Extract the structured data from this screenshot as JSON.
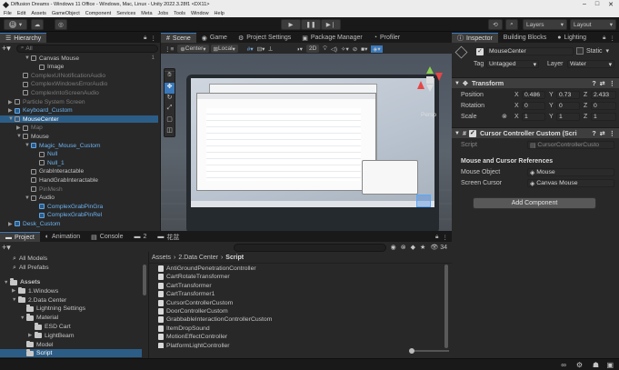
{
  "window": {
    "title": "Diffusion Dreams - Windows 11 Office - Windows, Mac, Linux - Unity 2022.3.28f1 <DX11>",
    "controls": [
      "–",
      "□",
      "✕"
    ]
  },
  "menu": [
    "File",
    "Edit",
    "Assets",
    "GameObject",
    "Component",
    "Services",
    "Meta",
    "Jobs",
    "Tools",
    "Window",
    "Help"
  ],
  "toolbar": {
    "account_initial": "R",
    "layers_label": "Layers",
    "layout_label": "Layout",
    "play_icon": "play-icon",
    "pause_icon": "pause-icon",
    "step_icon": "step-icon"
  },
  "hierarchy": {
    "tab": "Hierarchy",
    "search_placeholder": "All",
    "items": [
      {
        "label": "Canvas Mouse",
        "indent": 5,
        "icon": "cube",
        "arrow": "▼",
        "style": "normal",
        "right": "1"
      },
      {
        "label": "Image",
        "indent": 6,
        "icon": "cube",
        "arrow": "",
        "style": "normal"
      },
      {
        "label": "ComplexUINotificationAudio",
        "indent": 4,
        "icon": "cube",
        "arrow": "",
        "style": "dim"
      },
      {
        "label": "ComplexWindowsErrorAudio",
        "indent": 4,
        "icon": "cube",
        "arrow": "",
        "style": "dim"
      },
      {
        "label": "ComplexIntoScreenAudio",
        "indent": 4,
        "icon": "cube",
        "arrow": "",
        "style": "dim"
      },
      {
        "label": "Particle System Screen",
        "indent": 3,
        "icon": "cube",
        "arrow": "▶",
        "style": "dim"
      },
      {
        "label": "Keyboard_Custom",
        "indent": 3,
        "icon": "prefab",
        "arrow": "▶",
        "style": "blue"
      },
      {
        "label": "MouseCenter",
        "indent": 3,
        "icon": "cube",
        "arrow": "▼",
        "style": "selected"
      },
      {
        "label": "Map",
        "indent": 4,
        "icon": "cube",
        "arrow": "▶",
        "style": "dim"
      },
      {
        "label": "Mouse",
        "indent": 4,
        "icon": "cube",
        "arrow": "▼",
        "style": "normal"
      },
      {
        "label": "Magic_Mouse_Custom",
        "indent": 5,
        "icon": "prefab",
        "arrow": "▼",
        "style": "blue"
      },
      {
        "label": "Null",
        "indent": 6,
        "icon": "cube",
        "arrow": "",
        "style": "blue"
      },
      {
        "label": "Null_1",
        "indent": 6,
        "icon": "cube",
        "arrow": "",
        "style": "blue"
      },
      {
        "label": "GrabInteractable",
        "indent": 5,
        "icon": "cube",
        "arrow": "",
        "style": "normal"
      },
      {
        "label": "HandGrabInteractable",
        "indent": 5,
        "icon": "cube",
        "arrow": "",
        "style": "normal"
      },
      {
        "label": "PinMesh",
        "indent": 5,
        "icon": "cube",
        "arrow": "",
        "style": "dim"
      },
      {
        "label": "Audio",
        "indent": 5,
        "icon": "cube",
        "arrow": "▼",
        "style": "normal"
      },
      {
        "label": "ComplexGrabPinGra",
        "indent": 6,
        "icon": "prefab",
        "arrow": "",
        "style": "blue"
      },
      {
        "label": "ComplexGrabPinRel",
        "indent": 6,
        "icon": "prefab",
        "arrow": "",
        "style": "blue"
      },
      {
        "label": "Desk_Custom",
        "indent": 3,
        "icon": "prefab",
        "arrow": "▶",
        "style": "blue"
      }
    ]
  },
  "scene": {
    "tabs": [
      "Scene",
      "Game",
      "Project Settings",
      "Package Manager",
      "Profiler"
    ],
    "pivot_label": "Center",
    "space_label": "Local",
    "mode_2d": "2D",
    "persp_label": "Persp",
    "tools": [
      "hand-tool-icon",
      "move-tool-icon",
      "rotate-tool-icon",
      "scale-tool-icon",
      "rect-tool-icon",
      "transform-tool-icon"
    ]
  },
  "inspector": {
    "tabs": [
      "Inspector",
      "Building Blocks",
      "Lighting"
    ],
    "object_name": "MouseCenter",
    "static_label": "Static",
    "tag_label": "Tag",
    "tag_value": "Untagged",
    "layer_label": "Layer",
    "layer_value": "Water",
    "transform": {
      "title": "Transform",
      "position_label": "Position",
      "rotation_label": "Rotation",
      "scale_label": "Scale",
      "position": {
        "x": "0.486",
        "y": "0.73",
        "z": "2.433"
      },
      "rotation": {
        "x": "0",
        "y": "0",
        "z": "0"
      },
      "scale": {
        "x": "1",
        "y": "1",
        "z": "1"
      }
    },
    "component": {
      "title": "Cursor Controller Custom (Scri",
      "script_label": "Script",
      "script_value": "CursorControllerCusto",
      "section_title": "Mouse and Cursor References",
      "mouse_object_label": "Mouse Object",
      "mouse_object_value": "Mouse",
      "screen_cursor_label": "Screen Cursor",
      "screen_cursor_value": "Canvas Mouse"
    },
    "add_component": "Add Component"
  },
  "project": {
    "tabs": [
      "Project",
      "Animation",
      "Console",
      "2",
      "花盆"
    ],
    "badge": "34",
    "breadcrumb": [
      "Assets",
      "2.Data Center",
      "Script"
    ],
    "favorites": [
      "All Models",
      "All Prefabs"
    ],
    "tree": [
      {
        "label": "Assets",
        "indent": 0,
        "arrow": "▼",
        "bold": true
      },
      {
        "label": "1.Windows",
        "indent": 1,
        "arrow": "▶"
      },
      {
        "label": "2.Data Center",
        "indent": 1,
        "arrow": "▼"
      },
      {
        "label": "Lightning Settings",
        "indent": 2,
        "arrow": ""
      },
      {
        "label": "Material",
        "indent": 2,
        "arrow": "▼"
      },
      {
        "label": "ESD Cart",
        "indent": 3,
        "arrow": ""
      },
      {
        "label": "LightBeam",
        "indent": 3,
        "arrow": "▶"
      },
      {
        "label": "Model",
        "indent": 2,
        "arrow": ""
      },
      {
        "label": "Script",
        "indent": 2,
        "arrow": "",
        "selected": true
      }
    ],
    "files": [
      "AntiGroundPenetrationController",
      "CartRotateTransformer",
      "CartTransformer",
      "CartTransformer1",
      "CursorControllerCustom",
      "DoorControllerCustom",
      "GrabbableInteractionControllerCustom",
      "ItemDropSound",
      "MotionEffectController",
      "PlatformLightController"
    ]
  }
}
